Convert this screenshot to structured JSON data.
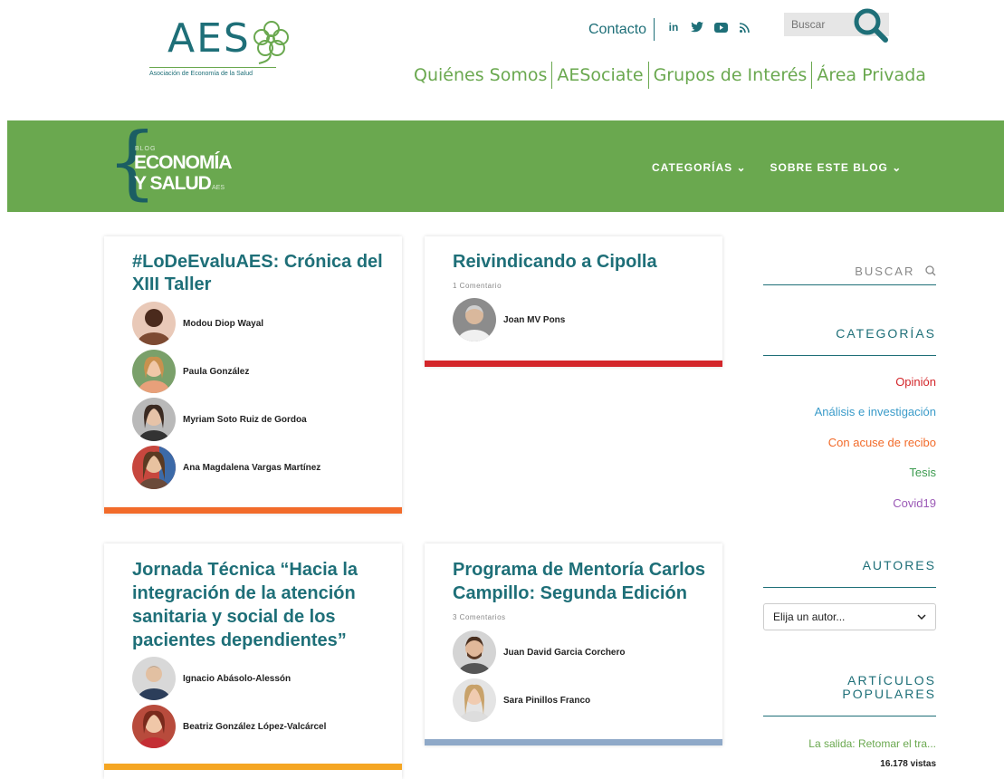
{
  "header": {
    "logo_text": "AES",
    "logo_subtitle": "Asociación de Economía de la Salud",
    "contact": "Contacto",
    "social": [
      "in",
      "twitter-icon",
      "youtube-icon",
      "rss-icon"
    ],
    "search_placeholder": "Buscar",
    "nav": [
      "Quiénes Somos",
      "AESociate",
      "Grupos de Interés",
      "Área Privada"
    ]
  },
  "blog": {
    "logo_small": "BLOG",
    "logo_line1": "ECONOMÍA",
    "logo_line2": "Y SALUD",
    "logo_tag": "AES",
    "nav": [
      {
        "label": "CATEGORÍAS ⌄"
      },
      {
        "label": "SOBRE ESTE BLOG ⌄"
      }
    ]
  },
  "posts": [
    {
      "title": "#LoDeEvaluAES: Crónica del XIII Taller",
      "comments": "",
      "authors": [
        "Modou Diop Wayal",
        "Paula González",
        "Myriam Soto Ruiz de Gordoa",
        "Ana Magdalena Vargas Martínez"
      ],
      "bar_color": "#f26b2a"
    },
    {
      "title": "Reivindicando a Cipolla",
      "comments": "1 Comentario",
      "authors": [
        "Joan MV Pons"
      ],
      "bar_color": "#d3262a"
    },
    {
      "title": "Jornada Técnica “Hacia la integración de la atención sanitaria y social de los pacientes dependientes”",
      "comments": "",
      "authors": [
        "Ignacio Abásolo-Alessón",
        "Beatriz González López-Valcárcel"
      ],
      "bar_color": "#f5a623"
    },
    {
      "title": "Programa de Mentoría Carlos Campillo: Segunda Edición",
      "comments": "3 Comentarios",
      "authors": [
        "Juan David Garcia Corchero",
        "Sara Pinillos Franco"
      ],
      "bar_color": "#8fa9c8"
    }
  ],
  "sidebar": {
    "search_label": "BUSCAR",
    "categories_title": "CATEGORÍAS",
    "categories": [
      {
        "label": "Opinión",
        "color": "#d3262a"
      },
      {
        "label": "Análisis e investigación",
        "color": "#3a9bc9"
      },
      {
        "label": "Con acuse de recibo",
        "color": "#f26b2a"
      },
      {
        "label": "Tesis",
        "color": "#3d9b50"
      },
      {
        "label": "Covid19",
        "color": "#9b59b6"
      }
    ],
    "authors_title": "AUTORES",
    "authors_select": "Elija un autor...",
    "popular_title_1": "ARTÍCULOS",
    "popular_title_2": "POPULARES",
    "popular_item": "La salida: Retomar el tra...",
    "popular_views": "16.178 vistas"
  },
  "colors": {
    "brand_teal": "#1e6f78",
    "brand_green": "#6aa84f"
  }
}
